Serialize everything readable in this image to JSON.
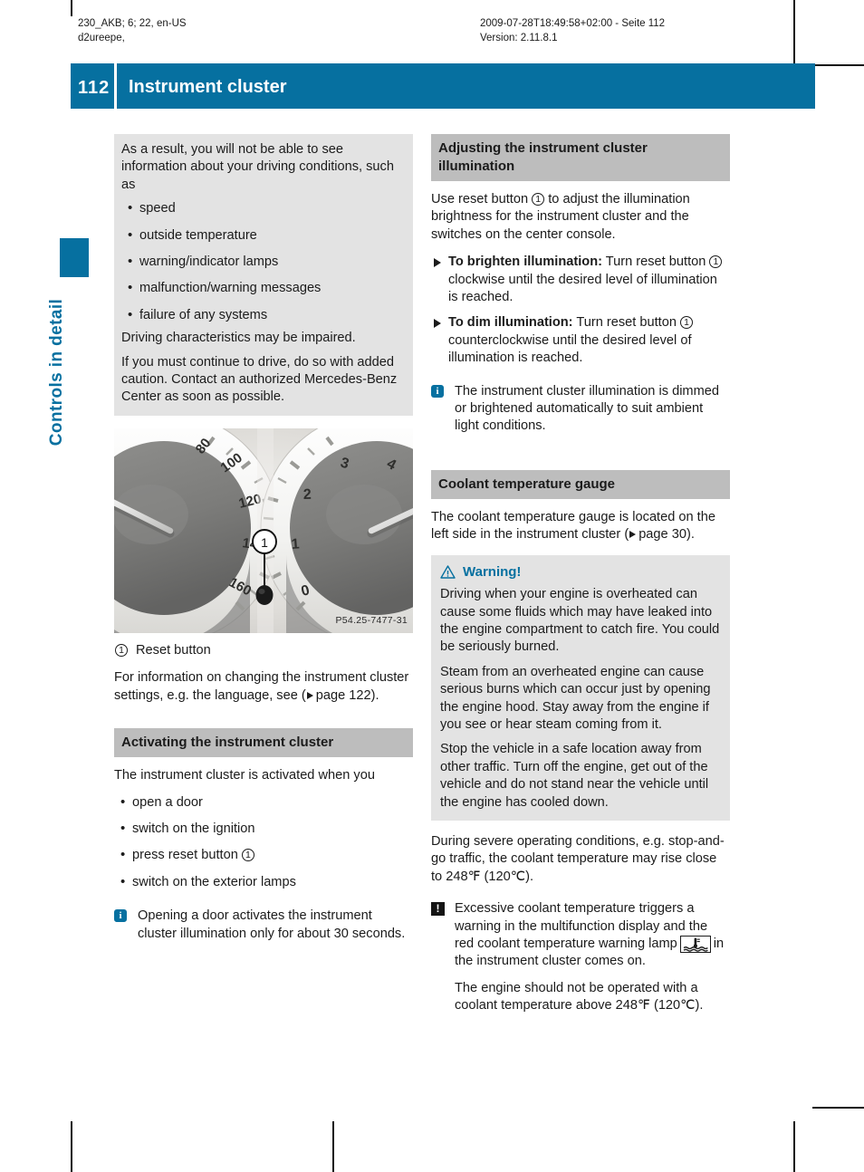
{
  "meta": {
    "left_line1": "230_AKB; 6; 22, en-US",
    "left_line2": "d2ureepe,",
    "right_line1": "2009-07-28T18:49:58+02:00 - Seite 112",
    "right_line2": "Version: 2.11.8.1"
  },
  "header": {
    "page_number": "112",
    "title": "Instrument cluster",
    "accent_color": "#0670a0"
  },
  "sidebar": {
    "chapter_label": "Controls in detail"
  },
  "left_column": {
    "continued_warning": {
      "intro": "As a result, you will not be able to see information about your driving conditions, such as",
      "bullets": [
        "speed",
        "outside temperature",
        "warning/indicator lamps",
        "malfunction/warning messages",
        "failure of any systems"
      ],
      "para1": "Driving characteristics may be impaired.",
      "para2": "If you must continue to drive, do so with added caution. Contact an authorized Mercedes-Benz Center as soon as possible."
    },
    "figure": {
      "image_id": "P54.25-7477-31",
      "callout": "1",
      "speedometer_ticks": [
        "80",
        "100",
        "120",
        "140",
        "160"
      ],
      "tachometer_ticks": [
        "0",
        "1",
        "2",
        "3",
        "4"
      ]
    },
    "legend": {
      "number": "1",
      "text": "Reset button"
    },
    "info_para": {
      "before": "For information on changing the instrument cluster settings, e.g. the language, see (",
      "page_word": "page 122",
      "after": ")."
    },
    "activating": {
      "heading": "Activating the instrument cluster",
      "lead": "The instrument cluster is activated when you",
      "bullets": [
        "open a door",
        "switch on the ignition",
        "press reset button",
        "switch on the exterior lamps"
      ],
      "bullet3_callout": "1",
      "note": "Opening a door activates the instrument cluster illumination only for about 30 seconds.",
      "note_icon": "info-icon"
    }
  },
  "right_column": {
    "adjusting": {
      "heading": "Adjusting the instrument cluster illumination",
      "lead_a": "Use reset button",
      "lead_callout": "1",
      "lead_b": "to adjust the illumination brightness for the instrument cluster and the switches on the center console.",
      "steps": [
        {
          "bold": "To brighten illumination:",
          "text_a": "Turn reset button",
          "callout": "1",
          "text_b": "clockwise until the desired level of illumination is reached."
        },
        {
          "bold": "To dim illumination:",
          "text_a": "Turn reset button",
          "callout": "1",
          "text_b": "counterclockwise until the desired level of illumination is reached."
        }
      ],
      "note": "The instrument cluster illumination is dimmed or brightened automatically to suit ambient light conditions.",
      "note_icon": "info-icon"
    },
    "coolant": {
      "heading": "Coolant temperature gauge",
      "intro_a": "The coolant temperature gauge is located on the left side in the instrument cluster (",
      "intro_page": "page 30",
      "intro_b": ").",
      "warning": {
        "icon": "warning-triangle-icon",
        "title": "Warning!",
        "paragraphs": [
          "Driving when your engine is overheated can cause some fluids which may have leaked into the engine compartment to catch fire. You could be seriously burned.",
          "Steam from an overheated engine can cause serious burns which can occur just by opening the engine hood. Stay away from the engine if you see or hear steam coming from it.",
          "Stop the vehicle in a safe location away from other traffic. Turn off the engine, get out of the vehicle and do not stand near the vehicle until the engine has cooled down."
        ]
      },
      "severe_para": "During severe operating conditions, e.g. stop-and-go traffic, the coolant temperature may rise close to 248℉ (120℃).",
      "caution": {
        "icon": "exclamation-box-icon",
        "text_a": "Excessive coolant temperature triggers a warning in the multifunction display and the red coolant temperature warning lamp",
        "lamp_icon": "coolant-temperature-lamp-icon",
        "text_b": "in the instrument cluster comes on."
      },
      "closing_para": "The engine should not be operated with a coolant temperature above 248℉ (120℃)."
    }
  }
}
